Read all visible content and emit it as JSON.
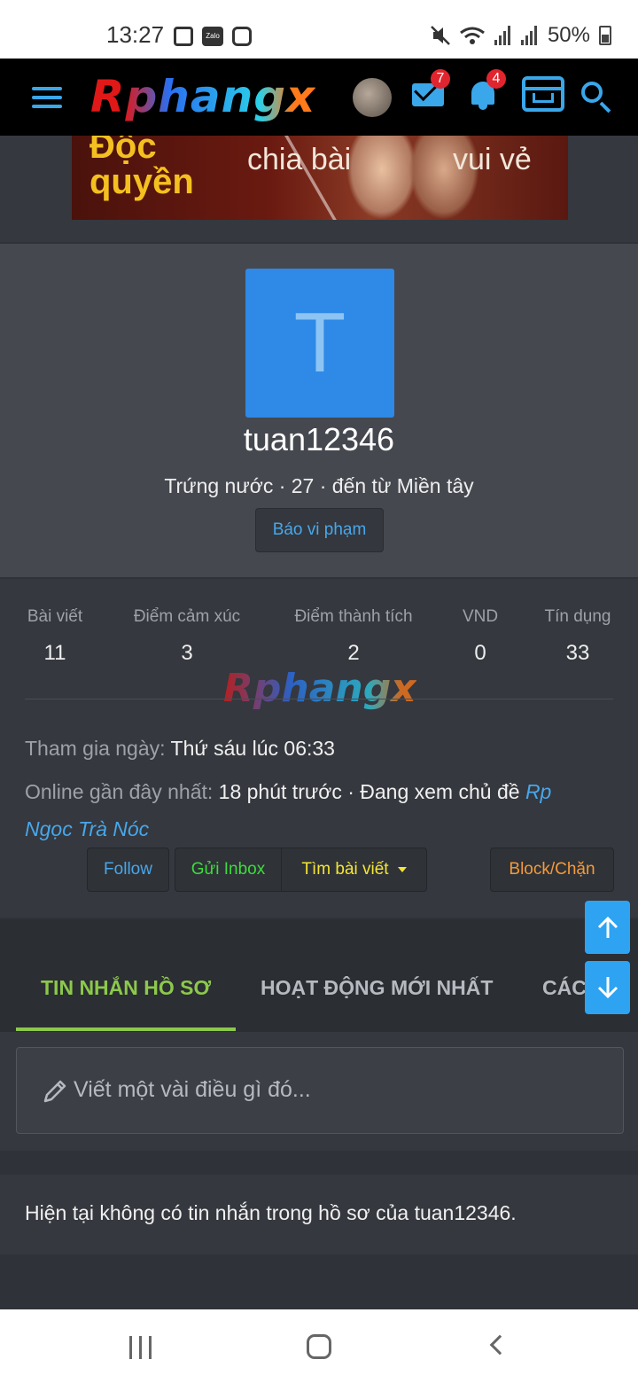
{
  "status_bar": {
    "time": "13:27",
    "battery": "50%",
    "zalo": "Zalo"
  },
  "header": {
    "logo": "Rphangx",
    "inbox_badge": "7",
    "alerts_badge": "4"
  },
  "banner": {
    "line1": "Độc",
    "line2": "quyền",
    "text_mid": "chia bài",
    "text_right": "vui vẻ"
  },
  "profile": {
    "avatar_letter": "T",
    "username": "tuan12346",
    "title": "Trứng nước · 27 · đến từ Miền tây",
    "report_label": "Báo vi phạm"
  },
  "stats": [
    {
      "label": "Bài viết",
      "value": "11"
    },
    {
      "label": "Điểm cảm xúc",
      "value": "3"
    },
    {
      "label": "Điểm thành tích",
      "value": "2"
    },
    {
      "label": "VND",
      "value": "0"
    },
    {
      "label": "Tín dụng",
      "value": "33"
    }
  ],
  "watermark": "Rphangx",
  "info": {
    "joined_label": "Tham gia ngày:",
    "joined_value": "Thứ sáu lúc 06:33",
    "online_label": "Online gần đây nhất:",
    "online_value": "18 phút trước · Đang xem chủ đề",
    "online_link_line1": "Rp",
    "online_link_line2": "Ngọc Trà Nóc"
  },
  "actions": {
    "follow": "Follow",
    "inbox": "Gửi Inbox",
    "find_posts": "Tìm bài viết",
    "block": "Block/Chặn"
  },
  "tabs": [
    {
      "label": "TIN NHẮN HỒ SƠ",
      "active": true
    },
    {
      "label": "HOẠT ĐỘNG MỚI NHẤT",
      "active": false
    },
    {
      "label": "CÁC",
      "active": false
    }
  ],
  "compose": {
    "placeholder": "Viết một vài điều gì đó..."
  },
  "empty_message": "Hiện tại không có tin nhắn trong hồ sơ của tuan12346.",
  "colors": {
    "accent": "#47a7eb",
    "active_tab": "#8cc84b",
    "inbox_green": "#3ddc3d",
    "find_yellow": "#f5e534",
    "block_orange": "#f59a3a"
  }
}
